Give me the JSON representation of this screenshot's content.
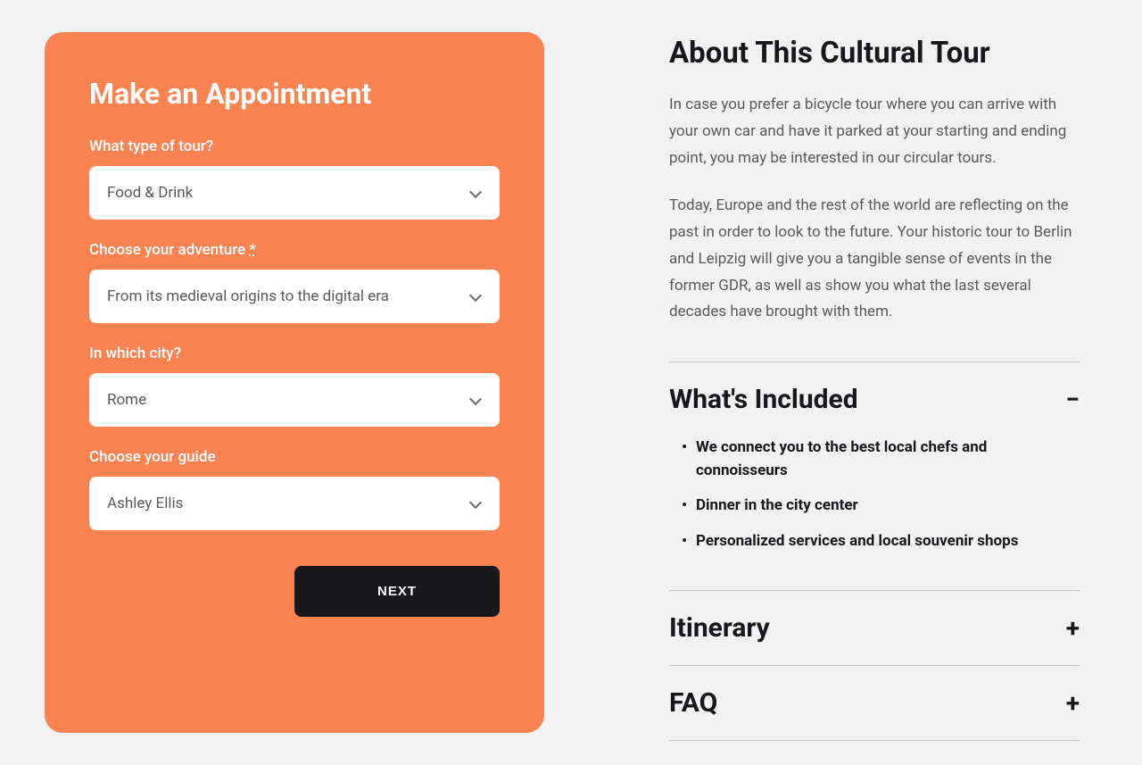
{
  "booking": {
    "title": "Make an Appointment",
    "fields": {
      "tourType": {
        "label": "What type of tour?",
        "value": "Food & Drink"
      },
      "adventure": {
        "label": "Choose your adventure",
        "required": "*",
        "value": "From its medieval origins to the digital era"
      },
      "city": {
        "label": "In which city?",
        "value": "Rome"
      },
      "guide": {
        "label": "Choose your guide",
        "value": "Ashley Ellis"
      }
    },
    "nextButton": "NEXT"
  },
  "about": {
    "title": "About This Cultural Tour",
    "paragraph1": "In case you prefer a bicycle tour where you can arrive with your own car and have it parked at your starting and ending point, you may be interested in our circular tours.",
    "paragraph2": "Today, Europe and the rest of the world are reflecting on the past in order to look to the future. Your historic tour to Berlin and Leipzig will give you a tangible sense of events in the former GDR, as well as show you what the last several decades have brought with them."
  },
  "accordion": {
    "included": {
      "title": "What's Included",
      "icon": "−",
      "items": [
        "We connect you to the best local chefs and connoisseurs",
        "Dinner in the city center",
        "Personalized services and local souvenir shops"
      ]
    },
    "itinerary": {
      "title": "Itinerary",
      "icon": "+"
    },
    "faq": {
      "title": "FAQ",
      "icon": "+"
    }
  }
}
